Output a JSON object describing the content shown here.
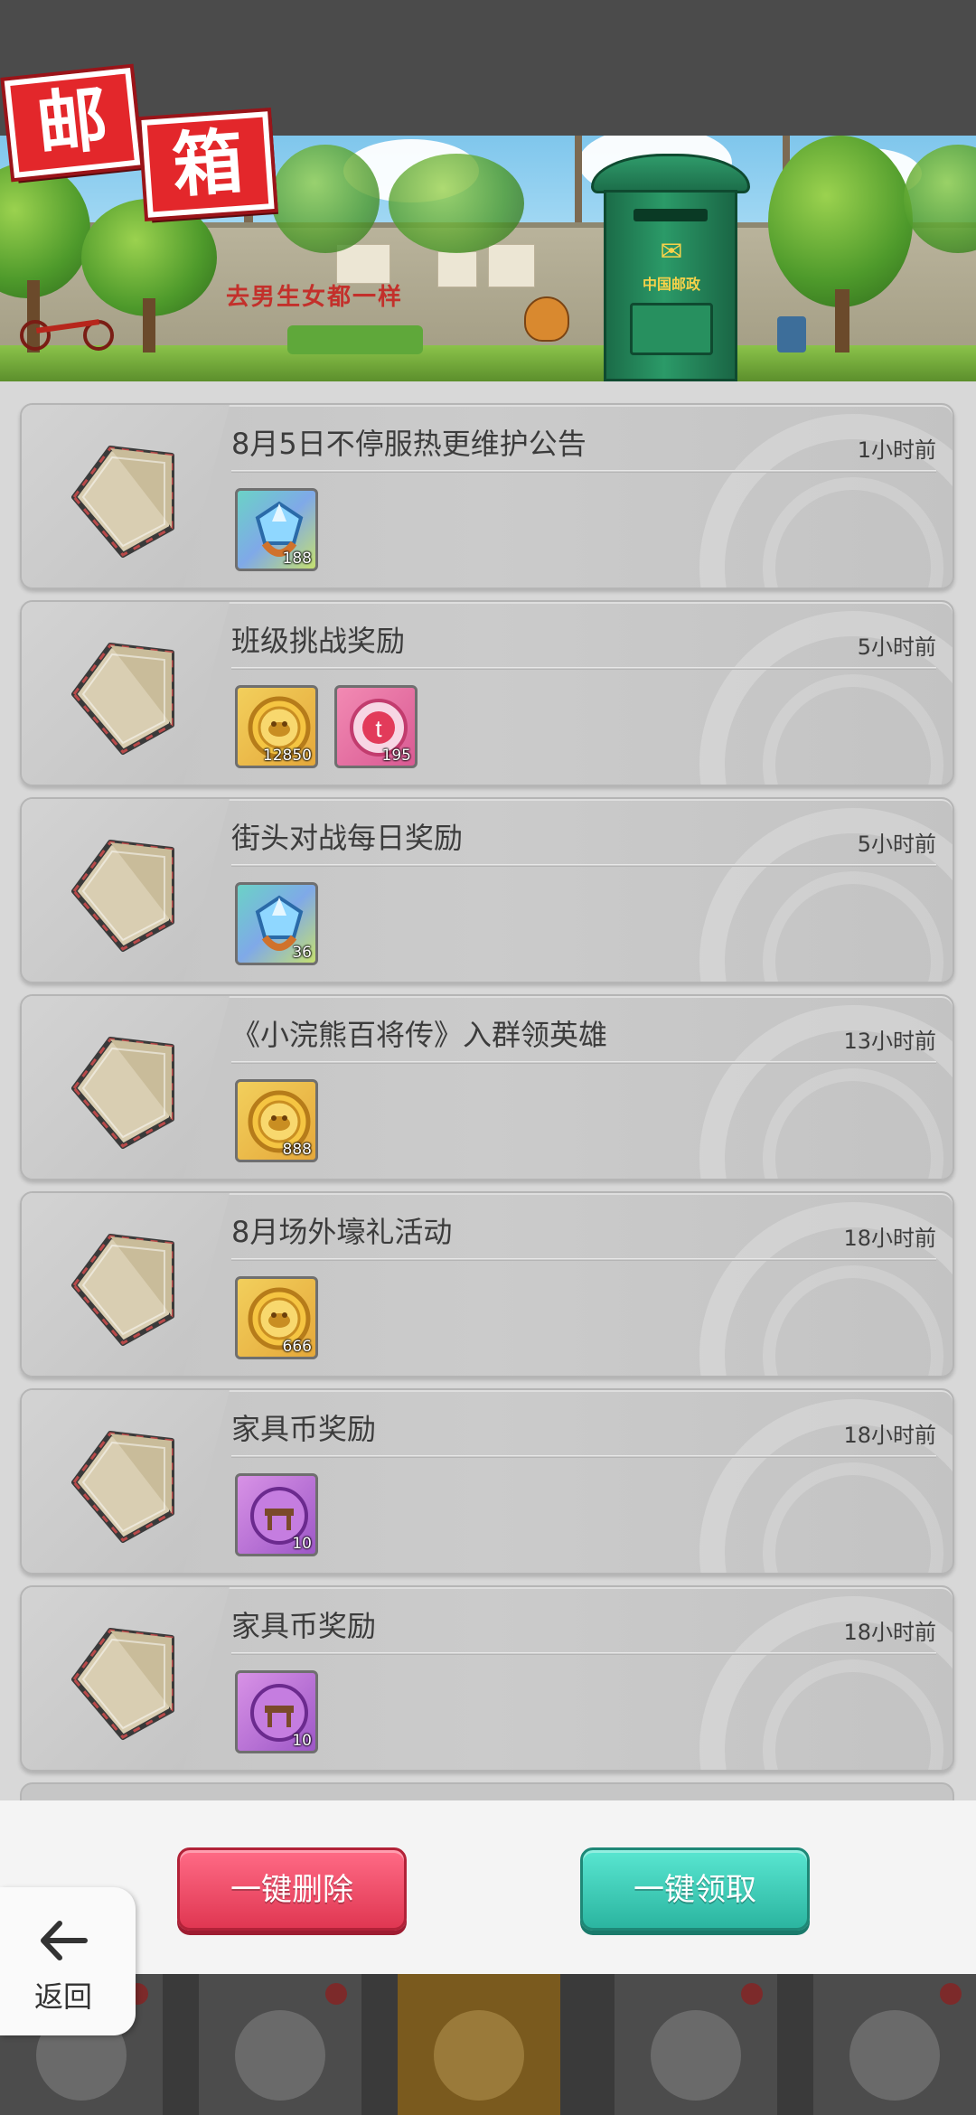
{
  "header": {
    "title_chars": [
      "邮",
      "箱"
    ],
    "graffiti": "去男生女都一样",
    "mailbox_label": "中国邮政"
  },
  "mails": [
    {
      "title": "8月5日不停服热更维护公告",
      "time": "1小时前",
      "rewards": [
        {
          "type": "gem",
          "icon": "gem-icon",
          "qty": "188"
        }
      ]
    },
    {
      "title": "班级挑战奖励",
      "time": "5小时前",
      "rewards": [
        {
          "type": "coin",
          "icon": "coin-icon",
          "qty": "12850"
        },
        {
          "type": "pink",
          "icon": "pink-token-icon",
          "qty": "195"
        }
      ]
    },
    {
      "title": "街头对战每日奖励",
      "time": "5小时前",
      "rewards": [
        {
          "type": "gem",
          "icon": "gem-icon",
          "qty": "36"
        }
      ]
    },
    {
      "title": "《小浣熊百将传》入群领英雄",
      "time": "13小时前",
      "rewards": [
        {
          "type": "coin",
          "icon": "coin-icon",
          "qty": "888"
        }
      ]
    },
    {
      "title": "8月场外壕礼活动",
      "time": "18小时前",
      "rewards": [
        {
          "type": "coin",
          "icon": "coin-icon",
          "qty": "666"
        }
      ]
    },
    {
      "title": "家具币奖励",
      "time": "18小时前",
      "rewards": [
        {
          "type": "purple",
          "icon": "furniture-coin-icon",
          "qty": "10"
        }
      ]
    },
    {
      "title": "家具币奖励",
      "time": "18小时前",
      "rewards": [
        {
          "type": "purple",
          "icon": "furniture-coin-icon",
          "qty": "10"
        }
      ]
    }
  ],
  "actions": {
    "delete_all": "一键删除",
    "claim_all": "一键领取",
    "back": "返回"
  },
  "colors": {
    "delete": "#e03752",
    "claim": "#2bb5a0",
    "title_red": "#e3272b",
    "mailbox_green": "#1c6e4a"
  }
}
